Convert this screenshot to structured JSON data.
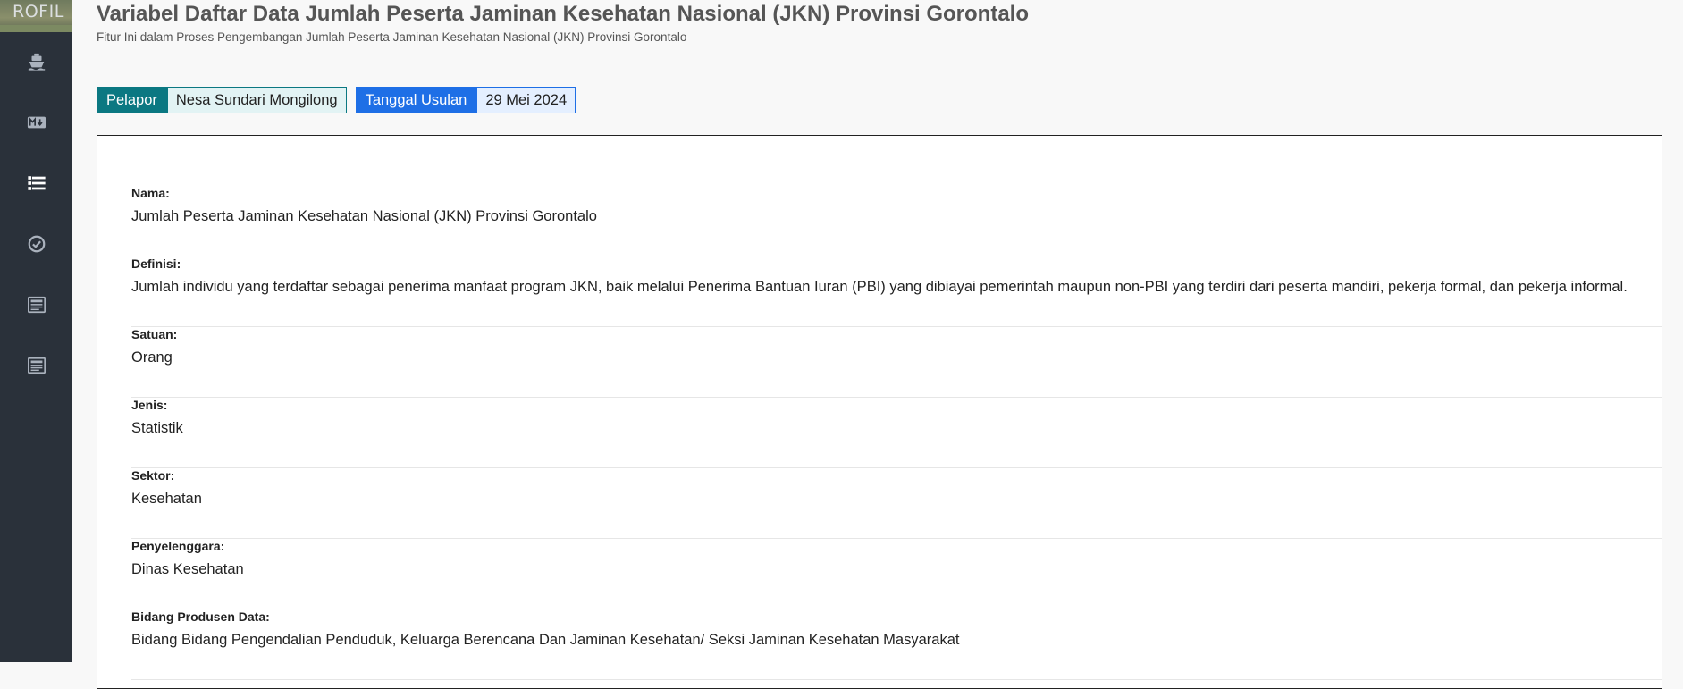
{
  "sidebar": {
    "logo_text": "ROFIL",
    "items": [
      {
        "icon": "ship-icon"
      },
      {
        "icon": "markdown-icon"
      },
      {
        "icon": "list-icon",
        "active": true
      },
      {
        "icon": "check-circle-icon"
      },
      {
        "icon": "newspaper-icon"
      },
      {
        "icon": "newspaper-icon"
      }
    ]
  },
  "header": {
    "title": "Variabel Daftar Data Jumlah Peserta Jaminan Kesehatan Nasional (JKN) Provinsi Gorontalo",
    "subtitle": "Fitur Ini dalam Proses Pengembangan Jumlah Peserta Jaminan Kesehatan Nasional (JKN) Provinsi Gorontalo"
  },
  "meta": {
    "pelapor_label": "Pelapor",
    "pelapor_value": "Nesa Sundari Mongilong",
    "tanggal_label": "Tanggal Usulan",
    "tanggal_value": "29 Mei 2024"
  },
  "fields": [
    {
      "label": "Nama:",
      "value": "Jumlah Peserta Jaminan Kesehatan Nasional (JKN) Provinsi Gorontalo"
    },
    {
      "label": "Definisi:",
      "value": "Jumlah individu yang terdaftar sebagai penerima manfaat program JKN, baik melalui Penerima Bantuan Iuran (PBI) yang dibiayai pemerintah maupun non-PBI yang terdiri dari peserta mandiri, pekerja formal, dan pekerja informal."
    },
    {
      "label": "Satuan:",
      "value": "Orang"
    },
    {
      "label": "Jenis:",
      "value": "Statistik"
    },
    {
      "label": "Sektor:",
      "value": "Kesehatan"
    },
    {
      "label": "Penyelenggara:",
      "value": "Dinas Kesehatan"
    },
    {
      "label": "Bidang Produsen Data:",
      "value": "Bidang Bidang Pengendalian Penduduk, Keluarga Berencana Dan Jaminan Kesehatan/ Seksi Jaminan Kesehatan Masyarakat"
    }
  ],
  "colors": {
    "sidebar_bg": "#2a313a",
    "icon_color": "#aab2bd",
    "pelapor_accent": "#0b7882",
    "tanggal_accent": "#1e6fe6"
  }
}
